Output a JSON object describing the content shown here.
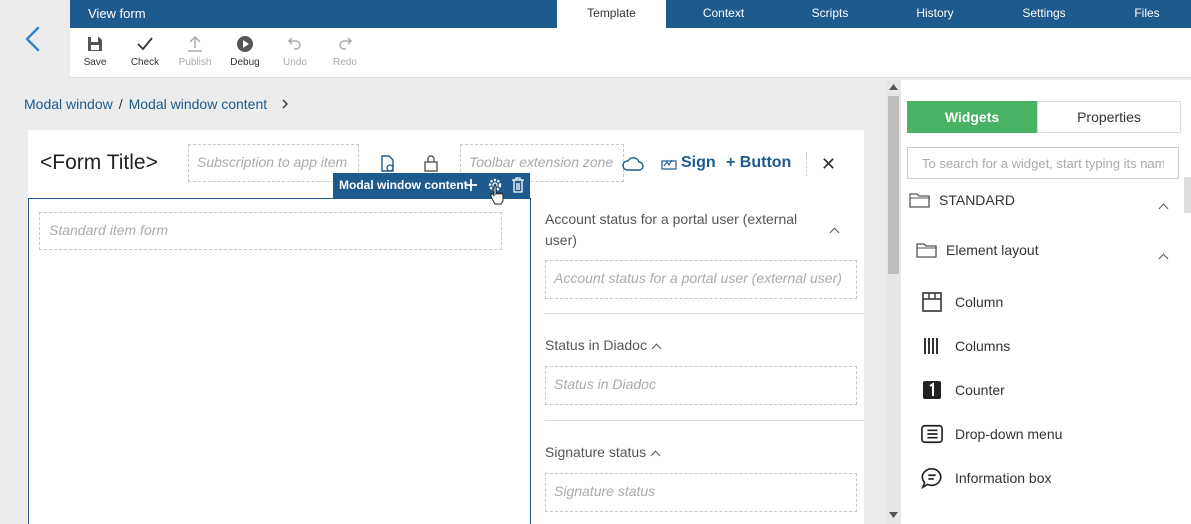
{
  "header": {
    "title": "View form",
    "tabs": [
      "Template",
      "Context",
      "Scripts",
      "History",
      "Settings",
      "Files"
    ],
    "active_tab": "Template"
  },
  "toolbar": {
    "save": "Save",
    "check": "Check",
    "publish": "Publish",
    "debug": "Debug",
    "undo": "Undo",
    "redo": "Redo"
  },
  "breadcrumb": {
    "root": "Modal window",
    "current": "Modal window content"
  },
  "form": {
    "title": "<Form Title>",
    "subscription_placeholder": "Subscription to app item",
    "toolbar_extension_placeholder": "Toolbar extension zone",
    "sign_label": "Sign",
    "button_label": "+ Button",
    "modal_bar_label": "Modal window content",
    "standard_item_form": "Standard item form",
    "sections": [
      {
        "label": "Account status for a portal user (external user)",
        "zone": "Account status for a portal user (external user)"
      },
      {
        "label": "Status in Diadoc",
        "zone": "Status in Diadoc"
      },
      {
        "label": "Signature status",
        "zone": "Signature status"
      }
    ]
  },
  "panel": {
    "tabs": {
      "widgets": "Widgets",
      "properties": "Properties"
    },
    "search_placeholder": "To search for a widget, start typing its name",
    "group_standard": "STANDARD",
    "group_layout": "Element layout",
    "items": [
      {
        "label": "Column",
        "icon": "column-icon"
      },
      {
        "label": "Columns",
        "icon": "columns-icon"
      },
      {
        "label": "Counter",
        "icon": "counter-icon"
      },
      {
        "label": "Drop-down menu",
        "icon": "dropdown-menu-icon"
      },
      {
        "label": "Information box",
        "icon": "information-box-icon"
      }
    ]
  },
  "colors": {
    "brand_blue": "#1d5a8e",
    "accent_green": "#4ab363"
  }
}
